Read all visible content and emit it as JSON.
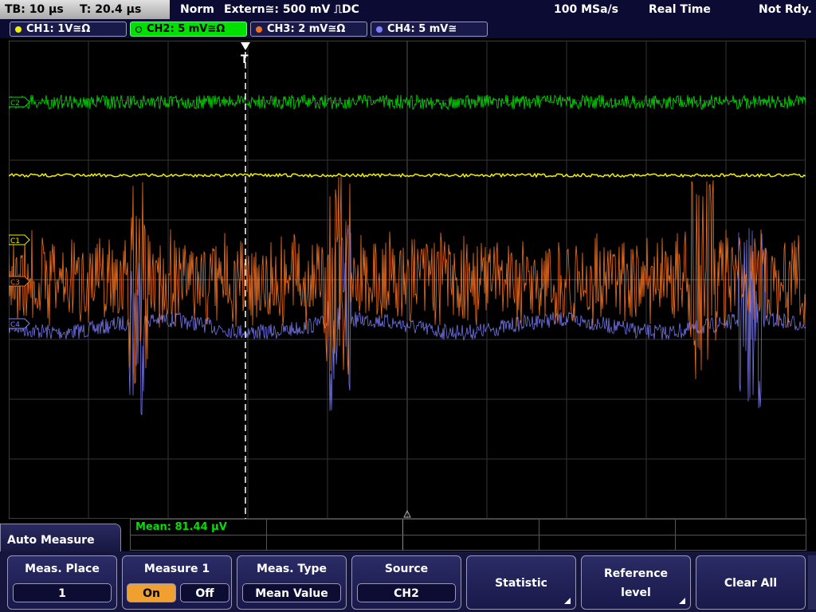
{
  "status": {
    "timebase": "TB: 10 µs",
    "trigger_time": "T: 20.4 µs",
    "trigger_mode": "Norm",
    "trigger_source": "Extern≅: 500 mV ⎍DC",
    "sample_rate": "100 MSa/s",
    "acq_mode": "Real Time",
    "state": "Not Rdy."
  },
  "channels": [
    {
      "label": "CH1: 1V≅Ω",
      "color": "#f0f000",
      "active": false,
      "marker": "C1"
    },
    {
      "label": "CH2: 5 mV≅Ω",
      "color": "#00e000",
      "active": true,
      "marker": "C2"
    },
    {
      "label": "CH3: 2 mV≅Ω",
      "color": "#f07020",
      "active": false,
      "marker": "C3"
    },
    {
      "label": "CH4: 5 mV≅",
      "color": "#8080ff",
      "active": false,
      "marker": "C4"
    }
  ],
  "measurement": {
    "readout": "Mean: 81.44 µV"
  },
  "menu": {
    "title": "Auto Measure",
    "softkeys": [
      {
        "caption": "Meas. Place",
        "value": "1"
      },
      {
        "caption": "Measure 1",
        "on": "On",
        "off": "Off",
        "selected": "On"
      },
      {
        "caption": "Meas. Type",
        "value": "Mean Value"
      },
      {
        "caption": "Source",
        "value": "CH2"
      },
      {
        "caption": "Statistic"
      },
      {
        "caption_line1": "Reference",
        "caption_line2": "level"
      },
      {
        "caption": "Clear All"
      }
    ]
  }
}
